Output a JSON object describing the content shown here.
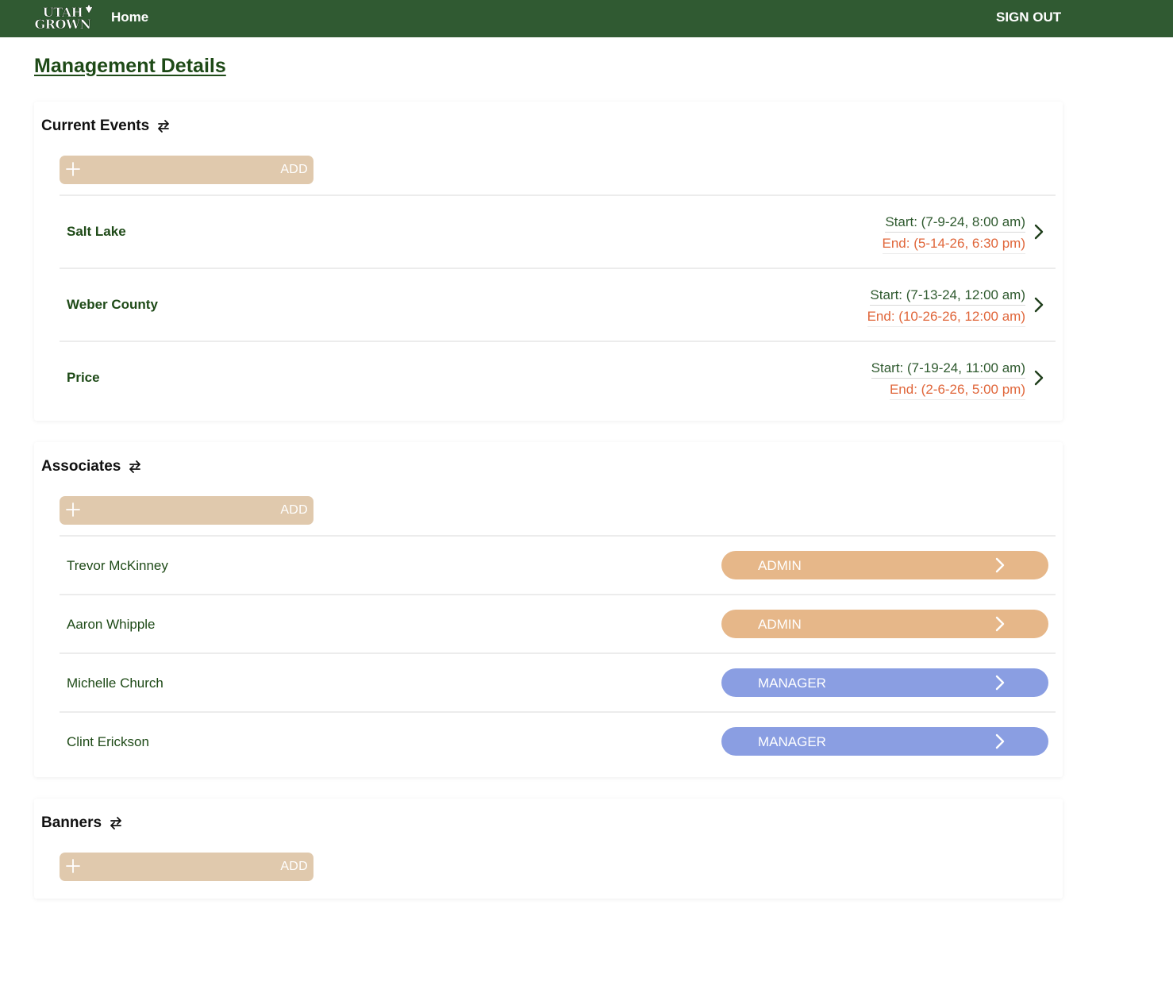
{
  "topbar": {
    "logo_line1": "UTAH",
    "logo_line2": "GROWN",
    "home_label": "Home",
    "sign_out_label": "SIGN OUT",
    "background": "#305a32"
  },
  "page_title": "Management Details",
  "sections": {
    "events": {
      "title": "Current Events",
      "add_label": "ADD",
      "items": [
        {
          "name": "Salt Lake",
          "start": "Start: (7-9-24, 8:00 am)",
          "end": "End: (5-14-26, 6:30 pm)"
        },
        {
          "name": "Weber County",
          "start": "Start: (7-13-24, 12:00 am)",
          "end": "End: (10-26-26, 12:00 am)"
        },
        {
          "name": "Price",
          "start": "Start: (7-19-24, 11:00 am)",
          "end": "End: (2-6-26, 5:00 pm)"
        }
      ]
    },
    "associates": {
      "title": "Associates",
      "add_label": "ADD",
      "items": [
        {
          "name": "Trevor McKinney",
          "role": "ADMIN"
        },
        {
          "name": "Aaron Whipple",
          "role": "ADMIN"
        },
        {
          "name": "Michelle Church",
          "role": "MANAGER"
        },
        {
          "name": "Clint Erickson",
          "role": "MANAGER"
        }
      ]
    },
    "banners": {
      "title": "Banners",
      "add_label": "ADD"
    }
  },
  "colors": {
    "brand_green": "#305a32",
    "text_green": "#1e4a17",
    "end_orange": "#e0663a",
    "add_tan": "#e0c9ad",
    "admin_orange": "#e6b789",
    "manager_blue": "#8a9ee2"
  }
}
